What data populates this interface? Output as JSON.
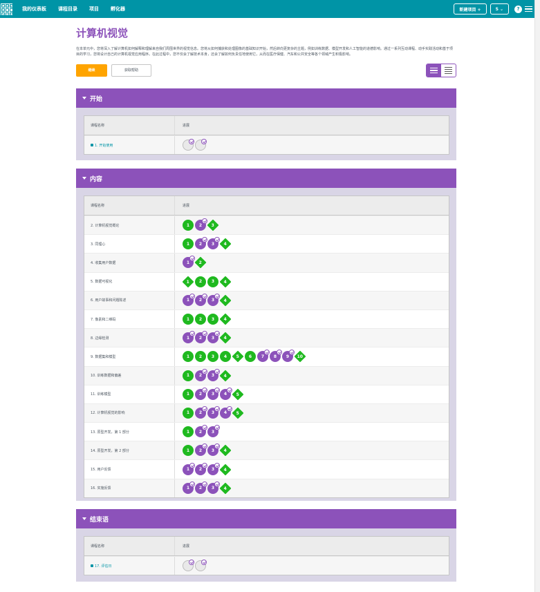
{
  "topbar": {
    "logo_letters": [
      "C",
      "O",
      "D",
      "E",
      "",
      "",
      "S",
      "T",
      "U"
    ],
    "nav": [
      "我的仪表板",
      "课程目录",
      "项目",
      "孵化器"
    ],
    "new_project": "新建项目 +",
    "user": "S ⌄",
    "help": "?"
  },
  "page": {
    "title": "计算机视觉",
    "description": "在本单元中，您将深入了解计算机如何解释和理解来自我们周围世界的视觉信息。您将从如何捕获和处理图像的基础知识开始，然后转向更复杂的主题，例如训练数据、模型开发和人工智能的道德影响。通过一系列互动课程、动手实践活动和基于项目的学习，您将设计自己的计算机视觉应用程序。在此过程中，您不仅会了解技术本身，还会了解如何负责任地使用它，从而在医疗保健、汽车和公共安全等各个领域产生积极影响。",
    "primary_button": "继续",
    "secondary_button": "获取帮助"
  },
  "columns": {
    "name": "课程名称",
    "progress": "进展"
  },
  "sections": [
    {
      "title": "开始",
      "lessons": [
        {
          "name": "1. 开始使用",
          "locked": true,
          "bubbles": [
            {
              "label": "",
              "kind": "e",
              "check": true
            },
            {
              "label": "",
              "kind": "e",
              "check": true
            }
          ]
        }
      ]
    },
    {
      "title": "内容",
      "lessons": [
        {
          "name": "2. 计算机视觉概论",
          "bubbles": [
            {
              "label": "1",
              "kind": "g"
            },
            {
              "label": "2",
              "kind": "p",
              "check": true
            },
            {
              "label": "3",
              "kind": "g",
              "diamond": true
            }
          ]
        },
        {
          "name": "3. 同理心",
          "bubbles": [
            {
              "label": "1",
              "kind": "g"
            },
            {
              "label": "2",
              "kind": "p",
              "check": true
            },
            {
              "label": "3",
              "kind": "p",
              "check": true
            },
            {
              "label": "4",
              "kind": "g",
              "diamond": true
            }
          ]
        },
        {
          "name": "4. 收集用户数据",
          "bubbles": [
            {
              "label": "1",
              "kind": "p",
              "check": true
            },
            {
              "label": "2",
              "kind": "g",
              "diamond": true
            }
          ]
        },
        {
          "name": "5. 数据可视化",
          "bubbles": [
            {
              "label": "1",
              "kind": "g",
              "diamond": true
            },
            {
              "label": "2",
              "kind": "g"
            },
            {
              "label": "3",
              "kind": "g"
            },
            {
              "label": "4",
              "kind": "g",
              "diamond": true
            }
          ]
        },
        {
          "name": "6. 用户故事和问题陈述",
          "bubbles": [
            {
              "label": "1",
              "kind": "p",
              "check": true
            },
            {
              "label": "2",
              "kind": "p",
              "check": true
            },
            {
              "label": "3",
              "kind": "p",
              "check": true
            },
            {
              "label": "4",
              "kind": "g",
              "diamond": true
            }
          ]
        },
        {
          "name": "7. 像素和二维码",
          "bubbles": [
            {
              "label": "1",
              "kind": "g"
            },
            {
              "label": "2",
              "kind": "g"
            },
            {
              "label": "3",
              "kind": "g"
            },
            {
              "label": "4",
              "kind": "g",
              "diamond": true
            }
          ]
        },
        {
          "name": "8. 边缘检测",
          "bubbles": [
            {
              "label": "1",
              "kind": "p",
              "check": true
            },
            {
              "label": "2",
              "kind": "p",
              "check": true
            },
            {
              "label": "3",
              "kind": "p",
              "check": true
            },
            {
              "label": "4",
              "kind": "g",
              "diamond": true
            }
          ]
        },
        {
          "name": "9. 数据集和模型",
          "bubbles": [
            {
              "label": "1",
              "kind": "g"
            },
            {
              "label": "2",
              "kind": "g"
            },
            {
              "label": "3",
              "kind": "g"
            },
            {
              "label": "4",
              "kind": "g"
            },
            {
              "label": "5",
              "kind": "g",
              "diamond": true
            },
            {
              "label": "6",
              "kind": "g"
            },
            {
              "label": "7",
              "kind": "p",
              "check": true
            },
            {
              "label": "8",
              "kind": "p",
              "check": true
            },
            {
              "label": "9",
              "kind": "p",
              "check": true
            },
            {
              "label": "10",
              "kind": "g",
              "diamond": true
            }
          ]
        },
        {
          "name": "10. 训练数据和偏差",
          "bubbles": [
            {
              "label": "1",
              "kind": "g"
            },
            {
              "label": "2",
              "kind": "p",
              "check": true
            },
            {
              "label": "3",
              "kind": "p",
              "check": true
            },
            {
              "label": "4",
              "kind": "g",
              "diamond": true
            }
          ]
        },
        {
          "name": "11. 训练模型",
          "bubbles": [
            {
              "label": "1",
              "kind": "g"
            },
            {
              "label": "2",
              "kind": "p",
              "check": true
            },
            {
              "label": "3",
              "kind": "p",
              "check": true
            },
            {
              "label": "4",
              "kind": "p",
              "check": true
            },
            {
              "label": "5",
              "kind": "g",
              "diamond": true
            }
          ]
        },
        {
          "name": "12. 计算机视觉的影响",
          "bubbles": [
            {
              "label": "1",
              "kind": "g"
            },
            {
              "label": "2",
              "kind": "p",
              "check": true
            },
            {
              "label": "3",
              "kind": "p",
              "check": true
            },
            {
              "label": "4",
              "kind": "p",
              "check": true
            },
            {
              "label": "5",
              "kind": "g",
              "diamond": true
            }
          ]
        },
        {
          "name": "13. 原型开发，第 1 部分",
          "bubbles": [
            {
              "label": "1",
              "kind": "g"
            },
            {
              "label": "2",
              "kind": "p",
              "check": true
            },
            {
              "label": "3",
              "kind": "p",
              "check": true
            }
          ]
        },
        {
          "name": "14. 原型开发，第 2 部分",
          "bubbles": [
            {
              "label": "1",
              "kind": "g"
            },
            {
              "label": "2",
              "kind": "p",
              "check": true
            },
            {
              "label": "3",
              "kind": "p",
              "check": true
            },
            {
              "label": "4",
              "kind": "g",
              "diamond": true
            }
          ]
        },
        {
          "name": "15. 用户反馈",
          "bubbles": [
            {
              "label": "1",
              "kind": "p",
              "check": true
            },
            {
              "label": "2",
              "kind": "p",
              "check": true
            },
            {
              "label": "3",
              "kind": "p",
              "check": true
            },
            {
              "label": "4",
              "kind": "g",
              "diamond": true
            }
          ]
        },
        {
          "name": "16. 实施反馈",
          "bubbles": [
            {
              "label": "1",
              "kind": "p",
              "check": true
            },
            {
              "label": "2",
              "kind": "p",
              "check": true
            },
            {
              "label": "3",
              "kind": "p",
              "check": true
            },
            {
              "label": "4",
              "kind": "g",
              "diamond": true
            }
          ]
        }
      ]
    },
    {
      "title": "结束语",
      "lessons": [
        {
          "name": "17. 评估日",
          "locked": true,
          "bubbles": [
            {
              "label": "",
              "kind": "e",
              "check": true
            },
            {
              "label": "",
              "kind": "e",
              "check": true
            }
          ]
        }
      ]
    }
  ]
}
